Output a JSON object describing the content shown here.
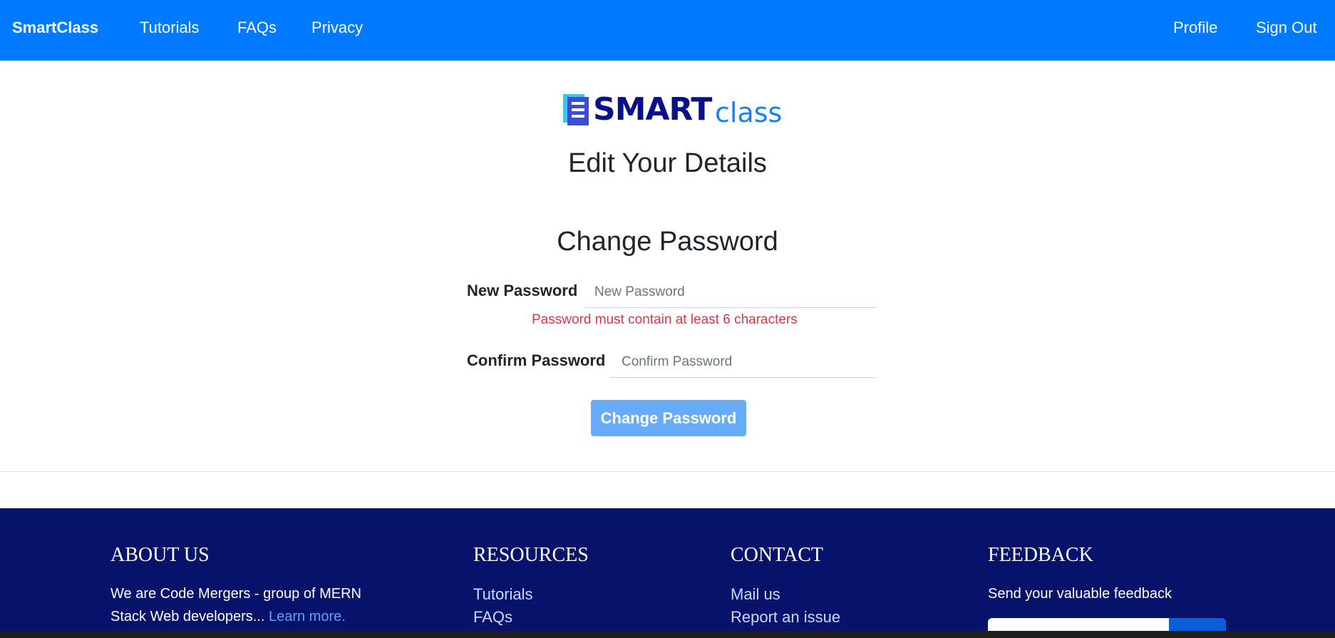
{
  "navbar": {
    "brand": "SmartClass",
    "links": [
      {
        "label": "Tutorials"
      },
      {
        "label": "FAQs"
      },
      {
        "label": "Privacy"
      }
    ],
    "right_links": [
      {
        "label": "Profile"
      },
      {
        "label": "Sign Out"
      }
    ]
  },
  "logo": {
    "part1": "SMART",
    "part2": "class"
  },
  "page": {
    "title": "Edit Your Details",
    "section_title": "Change Password"
  },
  "form": {
    "new_password": {
      "label": "New Password",
      "placeholder": "New Password",
      "value": "",
      "error": "Password must contain at least 6 characters"
    },
    "confirm_password": {
      "label": "Confirm Password",
      "placeholder": "Confirm Password",
      "value": ""
    },
    "submit_label": "Change Password"
  },
  "footer": {
    "about": {
      "heading": "ABOUT US",
      "text_line1": "We are Code Mergers - group of MERN",
      "text_line2": "Stack Web developers... ",
      "learn_more": "Learn more."
    },
    "resources": {
      "heading": "RESOURCES",
      "links": [
        {
          "label": "Tutorials"
        },
        {
          "label": "FAQs"
        }
      ]
    },
    "contact": {
      "heading": "CONTACT",
      "links": [
        {
          "label": "Mail us"
        },
        {
          "label": "Report an issue"
        }
      ]
    },
    "feedback": {
      "heading": "FEEDBACK",
      "text": "Send your valuable feedback"
    }
  },
  "colors": {
    "navbar": "#007bff",
    "footer": "#07136b",
    "error": "#dc3545",
    "button": "#66acf8"
  }
}
